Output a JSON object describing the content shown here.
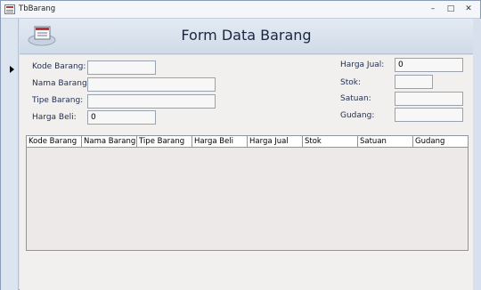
{
  "window": {
    "title": "TbBarang"
  },
  "form": {
    "title": "Form Data Barang"
  },
  "fields": {
    "kode_barang": {
      "label": "Kode Barang:",
      "value": ""
    },
    "nama_barang": {
      "label": "Nama Barang:",
      "value": ""
    },
    "tipe_barang": {
      "label": "Tipe Barang:",
      "value": ""
    },
    "harga_beli": {
      "label": "Harga Beli:",
      "value": "0"
    },
    "harga_jual": {
      "label": "Harga Jual:",
      "value": "0"
    },
    "stok": {
      "label": "Stok:",
      "value": ""
    },
    "satuan": {
      "label": "Satuan:",
      "value": ""
    },
    "gudang": {
      "label": "Gudang:",
      "value": ""
    }
  },
  "grid": {
    "columns": [
      "Kode Barang",
      "Nama Barang",
      "Tipe Barang",
      "Harga Beli",
      "Harga Jual",
      "Stok",
      "Satuan",
      "Gudang"
    ]
  }
}
